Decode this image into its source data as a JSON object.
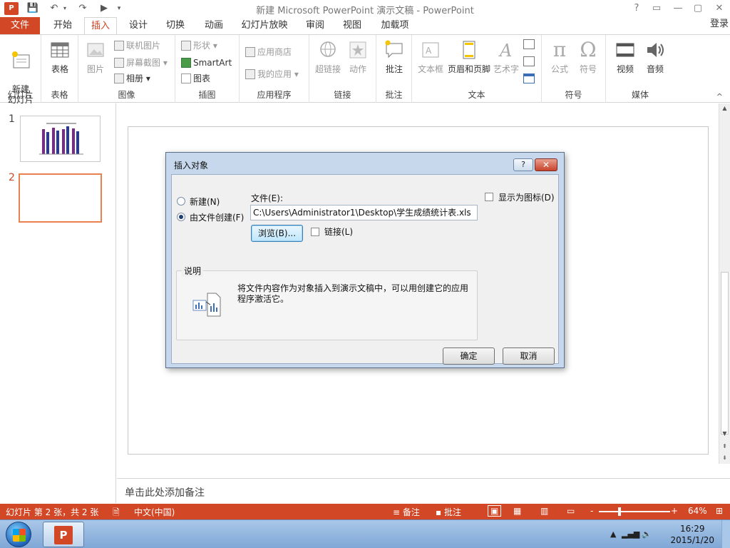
{
  "window": {
    "title": "新建 Microsoft PowerPoint 演示文稿 - PowerPoint",
    "app_badge": "P",
    "help": "?",
    "restore_ribbon": "▭",
    "minimize": "—",
    "maximize": "▢",
    "close": "✕"
  },
  "tabs": {
    "file": "文件",
    "items": [
      "开始",
      "插入",
      "设计",
      "切换",
      "动画",
      "幻灯片放映",
      "审阅",
      "视图",
      "加载项"
    ],
    "active": "插入",
    "login": "登录"
  },
  "ribbon": {
    "groups": {
      "slides": {
        "label": "幻灯片",
        "new_slide": "新建\n幻灯片"
      },
      "tables": {
        "label": "表格",
        "table": "表格"
      },
      "images": {
        "label": "图像",
        "picture": "图片",
        "online_pictures": "联机图片",
        "screenshot": "屏幕截图",
        "album": "相册"
      },
      "illustrations": {
        "label": "插图",
        "shapes": "形状",
        "smartart": "SmartArt",
        "chart": "图表"
      },
      "apps": {
        "label": "应用程序",
        "store": "应用商店",
        "my_apps": "我的应用"
      },
      "links": {
        "label": "链接",
        "hyperlink": "超链接",
        "action": "动作"
      },
      "comments": {
        "label": "批注",
        "comment": "批注"
      },
      "text": {
        "label": "文本",
        "textbox": "文本框",
        "header_footer": "页眉和页脚",
        "wordart": "艺术字"
      },
      "symbols": {
        "label": "符号",
        "equation": "公式",
        "symbol": "符号"
      },
      "media": {
        "label": "媒体",
        "video": "视频",
        "audio": "音频"
      }
    }
  },
  "thumbnails": [
    {
      "number": "1",
      "selected": false
    },
    {
      "number": "2",
      "selected": true
    }
  ],
  "notes": {
    "placeholder": "单击此处添加备注"
  },
  "statusbar": {
    "slide_info": "幻灯片 第 2 张，共 2 张",
    "language": "中文(中国)",
    "notes": "备注",
    "comments": "批注",
    "zoom_minus": "-",
    "zoom_plus": "+",
    "zoom": "64%"
  },
  "taskbar": {
    "time": "16:29",
    "date": "2015/1/20"
  },
  "dialog": {
    "title": "插入对象",
    "help_glyph": "?",
    "close_glyph": "✕",
    "radio_new": "新建(N)",
    "radio_from_file": "由文件创建(F)",
    "selected_option": "from_file",
    "file_label": "文件(E):",
    "file_value": "C:\\Users\\Administrator1\\Desktop\\学生成绩统计表.xls",
    "browse": "浏览(B)...",
    "link": "链接(L)",
    "display_as_icon": "显示为图标(D)",
    "desc_legend": "说明",
    "desc_text": "将文件内容作为对象插入到演示文稿中，可以用创建它的应用程序激活它。",
    "ok": "确定",
    "cancel": "取消"
  }
}
